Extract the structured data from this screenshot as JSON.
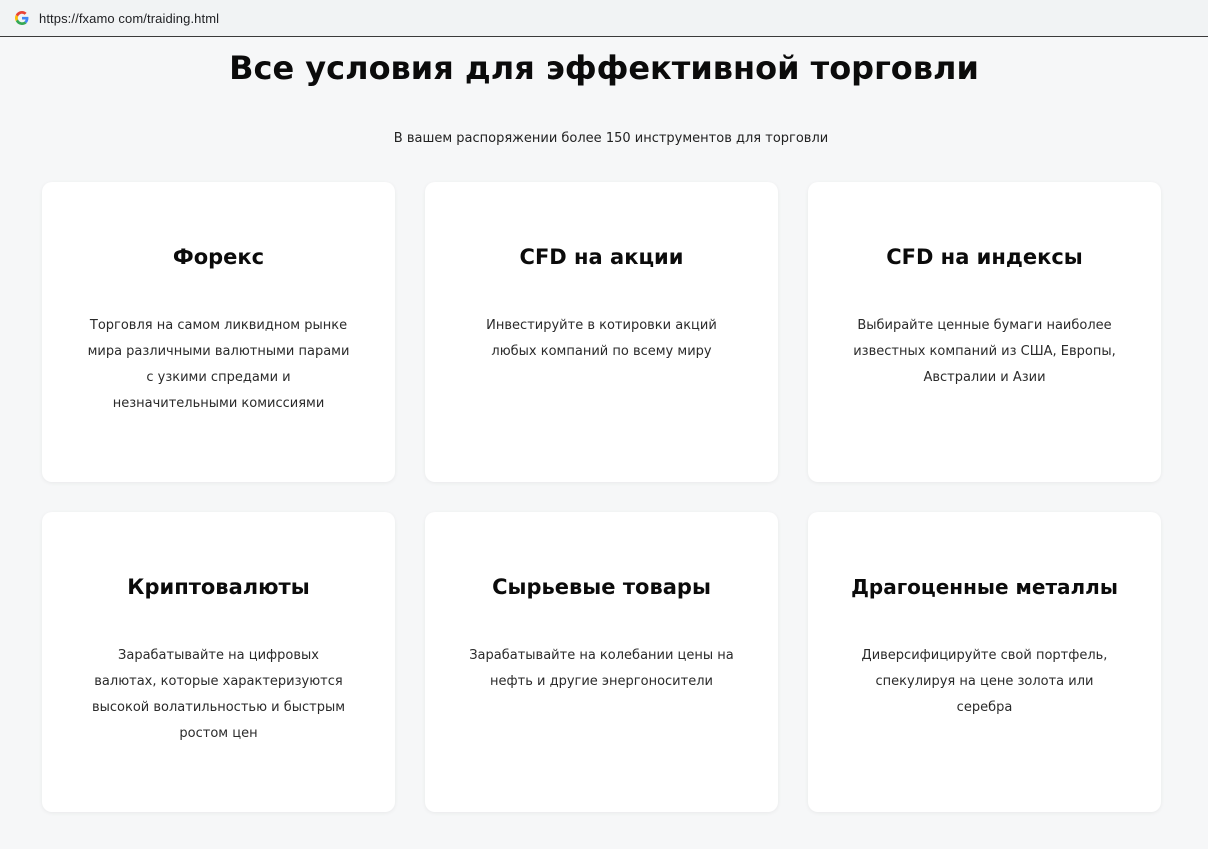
{
  "browser": {
    "url": "https://fxamo com/traiding.html",
    "icon": "google-g-icon"
  },
  "section": {
    "title": "Все условия для эффективной торговли",
    "subtitle": "В вашем распоряжении более 150 инструментов для торговли"
  },
  "cards": [
    {
      "title": "Форекс",
      "text": "Торговля на самом ликвидном рынке мира различными валютными парами с узкими спредами и незначительными комиссиями"
    },
    {
      "title": "CFD на акции",
      "text": "Инвестируйте в котировки акций любых компаний по всему миру"
    },
    {
      "title": "CFD на индексы",
      "text": "Выбирайте ценные бумаги наиболее известных компаний из США, Европы, Австралии и Азии"
    },
    {
      "title": "Криптовалюты",
      "text": "Зарабатывайте на цифровых валютах, которые характеризуются высокой волатильностью и быстрым ростом цен"
    },
    {
      "title": "Сырьевые товары",
      "text": "Зарабатывайте на колебании цены на нефть и другие энергоносители"
    },
    {
      "title": "Драгоценные металлы",
      "text": "Диверсифицируйте свой портфель, спекулируя на цене золота или серебра"
    }
  ],
  "colors": {
    "background": "#f6f7f8",
    "card": "#ffffff",
    "text": "#0b0b0b"
  }
}
